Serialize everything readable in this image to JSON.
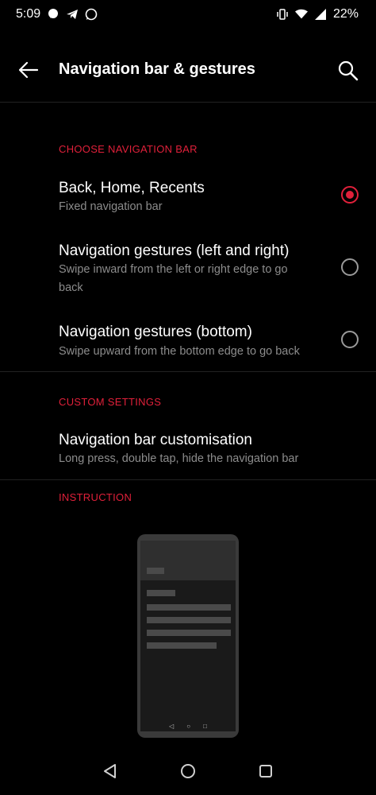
{
  "status": {
    "time": "5:09",
    "battery": "22%",
    "left_icons": [
      "signal-messenger-icon",
      "telegram-icon",
      "whatsapp-icon"
    ],
    "right_icons": [
      "vibrate-icon",
      "wifi-icon",
      "cell-signal-icon"
    ]
  },
  "header": {
    "title": "Navigation bar & gestures"
  },
  "sections": {
    "choose": {
      "label": "CHOOSE NAVIGATION BAR"
    },
    "custom": {
      "label": "CUSTOM SETTINGS"
    },
    "instruction": {
      "label": "INSTRUCTION"
    }
  },
  "options": [
    {
      "title": "Back, Home, Recents",
      "subtitle": "Fixed navigation bar",
      "selected": true
    },
    {
      "title": "Navigation gestures (left and right)",
      "subtitle": "Swipe inward from the left or right edge to go back",
      "selected": false
    },
    {
      "title": "Navigation gestures (bottom)",
      "subtitle": "Swipe upward from the bottom edge to go back",
      "selected": false
    }
  ],
  "custom": {
    "title": "Navigation bar customisation",
    "subtitle": "Long press, double tap, hide the navigation bar"
  },
  "colors": {
    "accent": "#e0203a",
    "background": "#000000",
    "secondary_text": "#8c8c8c"
  }
}
